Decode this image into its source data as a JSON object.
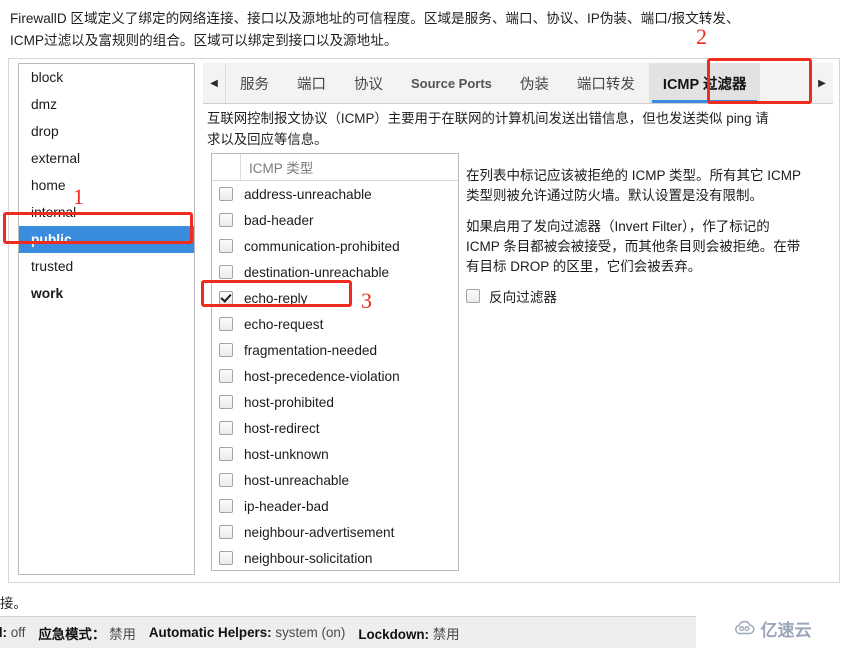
{
  "zone_description": {
    "line1": "FirewallD 区域定义了绑定的网络连接、接口以及源地址的可信程度。区域是服务、端口、协议、IP伪装、端口/报文转发、",
    "line2": "ICMP过滤以及富规则的组合。区域可以绑定到接口以及源地址。"
  },
  "zone_list": {
    "items": [
      {
        "label": "block",
        "selected": false,
        "bold": false
      },
      {
        "label": "dmz",
        "selected": false,
        "bold": false
      },
      {
        "label": "drop",
        "selected": false,
        "bold": false
      },
      {
        "label": "external",
        "selected": false,
        "bold": false
      },
      {
        "label": "home",
        "selected": false,
        "bold": false
      },
      {
        "label": "internal",
        "selected": false,
        "bold": false
      },
      {
        "label": "public",
        "selected": true,
        "bold": true
      },
      {
        "label": "trusted",
        "selected": false,
        "bold": false
      },
      {
        "label": "work",
        "selected": false,
        "bold": true
      }
    ]
  },
  "tabs": {
    "scroll_left_icon": "triangle-left-icon",
    "scroll_right_icon": "triangle-right-icon",
    "items": [
      {
        "label": "服务",
        "active": false,
        "latin": false
      },
      {
        "label": "端口",
        "active": false,
        "latin": false
      },
      {
        "label": "协议",
        "active": false,
        "latin": false
      },
      {
        "label": "Source Ports",
        "active": false,
        "latin": true
      },
      {
        "label": "伪装",
        "active": false,
        "latin": false
      },
      {
        "label": "端口转发",
        "active": false,
        "latin": false
      },
      {
        "label": "ICMP 过滤器",
        "active": true,
        "latin": false
      }
    ],
    "active_tab": "ICMP 过滤器"
  },
  "tab_description": {
    "line1": "互联网控制报文协议（ICMP）主要用于在联网的计算机间发送出错信息，但也发送类似 ping 请",
    "line2": "求以及回应等信息。"
  },
  "icmp_list": {
    "header": "ICMP 类型",
    "rows": [
      {
        "label": "address-unreachable",
        "checked": false
      },
      {
        "label": "bad-header",
        "checked": false
      },
      {
        "label": "communication-prohibited",
        "checked": false
      },
      {
        "label": "destination-unreachable",
        "checked": false
      },
      {
        "label": "echo-reply",
        "checked": true
      },
      {
        "label": "echo-request",
        "checked": false
      },
      {
        "label": "fragmentation-needed",
        "checked": false
      },
      {
        "label": "host-precedence-violation",
        "checked": false
      },
      {
        "label": "host-prohibited",
        "checked": false
      },
      {
        "label": "host-redirect",
        "checked": false
      },
      {
        "label": "host-unknown",
        "checked": false
      },
      {
        "label": "host-unreachable",
        "checked": false
      },
      {
        "label": "ip-header-bad",
        "checked": false
      },
      {
        "label": "neighbour-advertisement",
        "checked": false
      },
      {
        "label": "neighbour-solicitation",
        "checked": false
      }
    ]
  },
  "icmp_help": {
    "para1_line1": "在列表中标记应该被拒绝的 ICMP 类型。所有其它 ICMP",
    "para1_line2": "类型则被允许通过防火墙。默认设置是没有限制。",
    "para2_line1": "如果启用了发向过滤器（Invert Filter），作了标记的",
    "para2_line2": "ICMP 条目都被会被接受，而其他条目则会被拒绝。在带",
    "para2_line3": "有目标 DROP 的区里，它们会被丢弃。",
    "invert_filter_label": "反向过滤器",
    "invert_filter_checked": false
  },
  "bottom_text": "接。",
  "status_bar": {
    "segments": [
      {
        "key": "nied:",
        "value": "off"
      },
      {
        "key": "应急模式：",
        "value": "禁用"
      },
      {
        "key": "Automatic Helpers:",
        "value": "system (on)"
      },
      {
        "key": "Lockdown:",
        "value": "禁用"
      }
    ]
  },
  "annotations": {
    "n1": "1",
    "n2": "2",
    "n3": "3"
  },
  "watermark": {
    "icon": "cloud-icon",
    "text": "亿速云"
  },
  "colors": {
    "selection_blue": "#3a8dde",
    "annotation_red": "#ee2b1c",
    "status_bg": "#efeeec"
  }
}
